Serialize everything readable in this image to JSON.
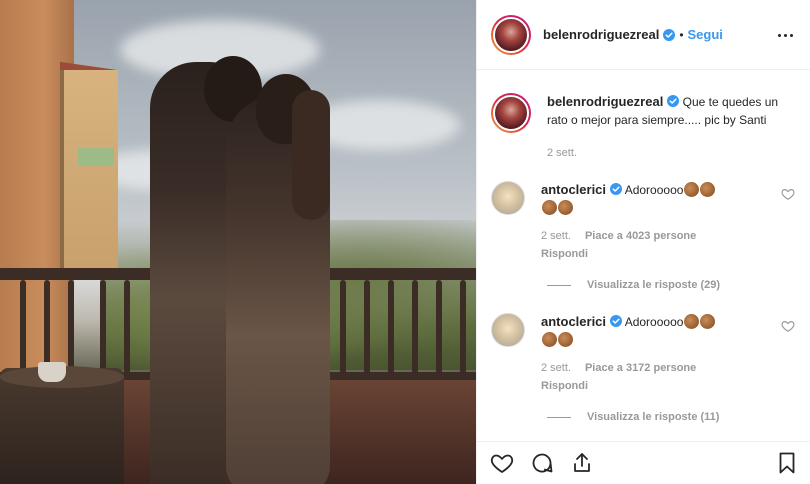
{
  "post": {
    "author": "belenrodriguezreal",
    "follow_label": "Segui",
    "separator": "•"
  },
  "caption": {
    "author": "belenrodriguezreal",
    "text": "Que te quedes un rato o mejor para siempre..... pic by Santi",
    "time": "2 sett."
  },
  "comments": [
    {
      "author": "antoclerici",
      "text_line1": "Adorooooo",
      "emoji_line1": [
        "clapping-hands",
        "clapping-hands"
      ],
      "emoji_line2": [
        "clapping-hands",
        "clapping-hands"
      ],
      "time": "2 sett.",
      "likes": "Piace a 4023 persone",
      "reply": "Rispondi",
      "view_replies": "Visualizza le risposte (29)"
    },
    {
      "author": "antoclerici",
      "text_line1": "Adorooooo",
      "emoji_line1": [
        "clapping-hands",
        "clapping-hands"
      ],
      "emoji_line2": [
        "clapping-hands",
        "clapping-hands"
      ],
      "time": "2 sett.",
      "likes": "Piace a 3172 persone",
      "reply": "Rispondi",
      "view_replies": "Visualizza le risposte (11)"
    }
  ],
  "actions": {
    "like": "heart-icon",
    "comment": "comment-icon",
    "share": "share-icon",
    "save": "bookmark-icon"
  },
  "colors": {
    "accent": "#3897f0",
    "verified": "#3897f0",
    "muted": "#999999",
    "text": "#262626",
    "border": "#efefef"
  }
}
